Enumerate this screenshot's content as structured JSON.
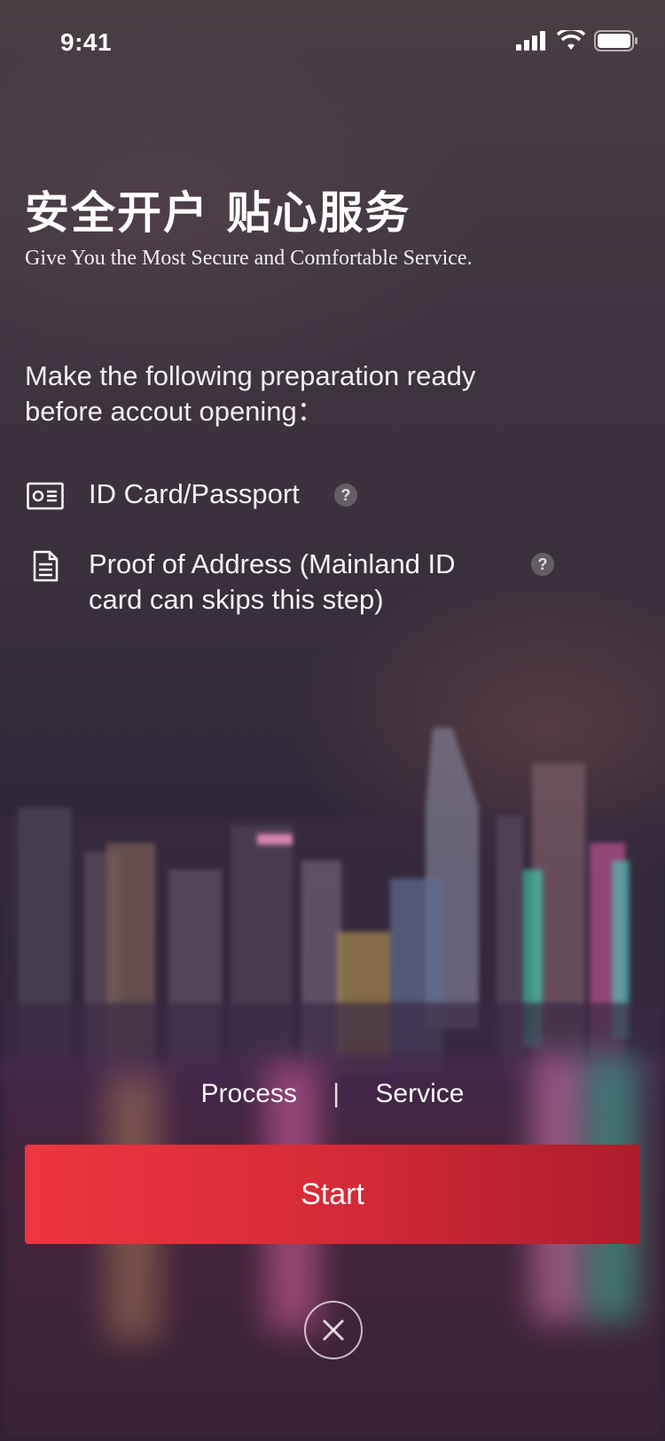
{
  "status_bar": {
    "time": "9:41"
  },
  "header": {
    "title_cn": "安全开户  贴心服务",
    "subtitle_en": "Give You the Most Secure and Comfortable Service."
  },
  "preparation": {
    "intro_line1": "Make the following preparation ready",
    "intro_line2": "before accout opening：",
    "items": [
      {
        "icon": "id-card-icon",
        "label": "ID Card/Passport",
        "help": "?"
      },
      {
        "icon": "document-icon",
        "label_line1": "Proof of Address (Mainland ID",
        "label_line2": "card can skips this step)",
        "help": "?"
      }
    ]
  },
  "footer_links": {
    "process": "Process",
    "divider": "|",
    "service": "Service"
  },
  "start_button": {
    "label": "Start"
  },
  "close_button": {
    "icon": "close-icon"
  },
  "colors": {
    "start_gradient_left": "#ee3640",
    "start_gradient_right": "#ad1c2c"
  }
}
